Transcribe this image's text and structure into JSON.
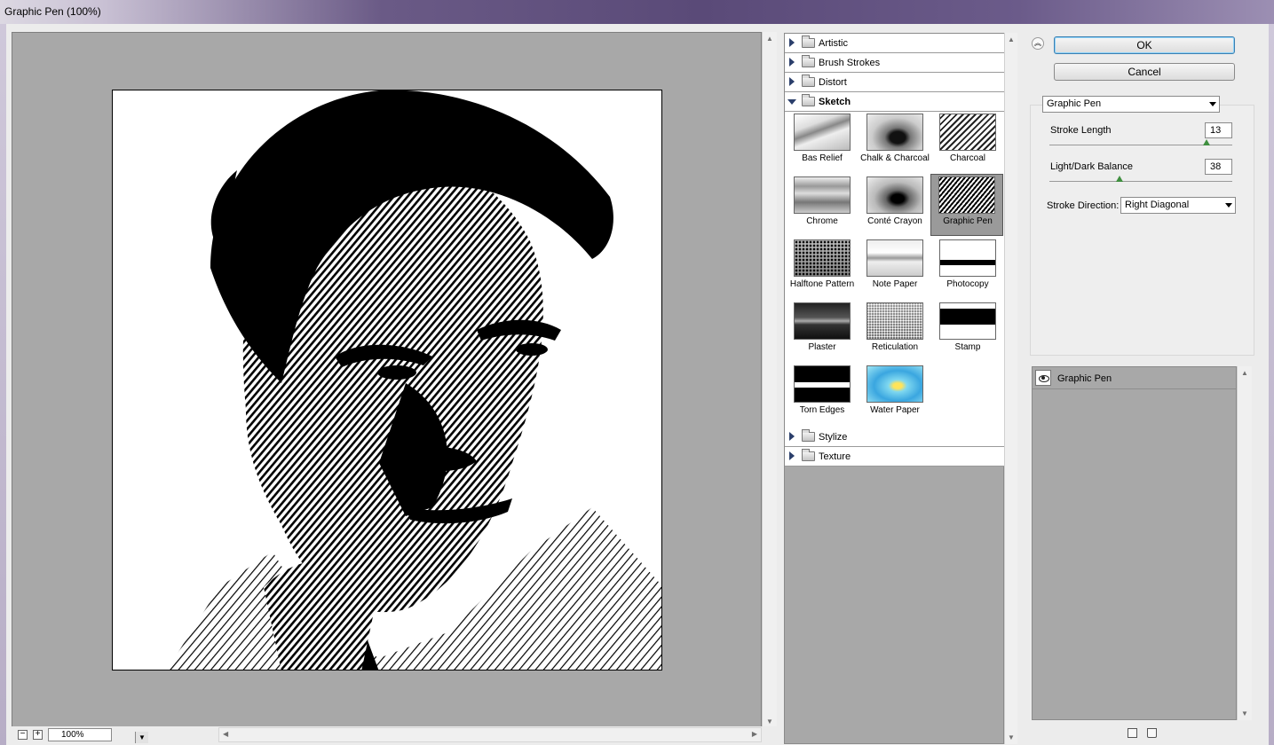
{
  "window": {
    "title": "Graphic Pen (100%)"
  },
  "preview": {
    "zoom": "100%"
  },
  "buttons": {
    "ok": "OK",
    "cancel": "Cancel"
  },
  "gallery": {
    "categories_top": [
      "Artistic",
      "Brush Strokes",
      "Distort"
    ],
    "open_category": "Sketch",
    "categories_bottom": [
      "Stylize",
      "Texture"
    ],
    "sketch_filters": [
      "Bas Relief",
      "Chalk & Charcoal",
      "Charcoal",
      "Chrome",
      "Conté Crayon",
      "Graphic Pen",
      "Halftone Pattern",
      "Note Paper",
      "Photocopy",
      "Plaster",
      "Reticulation",
      "Stamp",
      "Torn Edges",
      "Water Paper"
    ],
    "selected_filter": "Graphic Pen"
  },
  "settings": {
    "filter_select": "Graphic Pen",
    "stroke_length_label": "Stroke Length",
    "stroke_length": "13",
    "balance_label": "Light/Dark Balance",
    "balance": "38",
    "direction_label": "Stroke Direction:",
    "direction": "Right Diagonal"
  },
  "layers": [
    {
      "name": "Graphic Pen",
      "visible": true
    }
  ],
  "icons": [
    "collapse-icon",
    "eye-icon",
    "new-effect-layer-icon",
    "delete-effect-layer-icon",
    "zoom-out-icon",
    "zoom-in-icon"
  ]
}
